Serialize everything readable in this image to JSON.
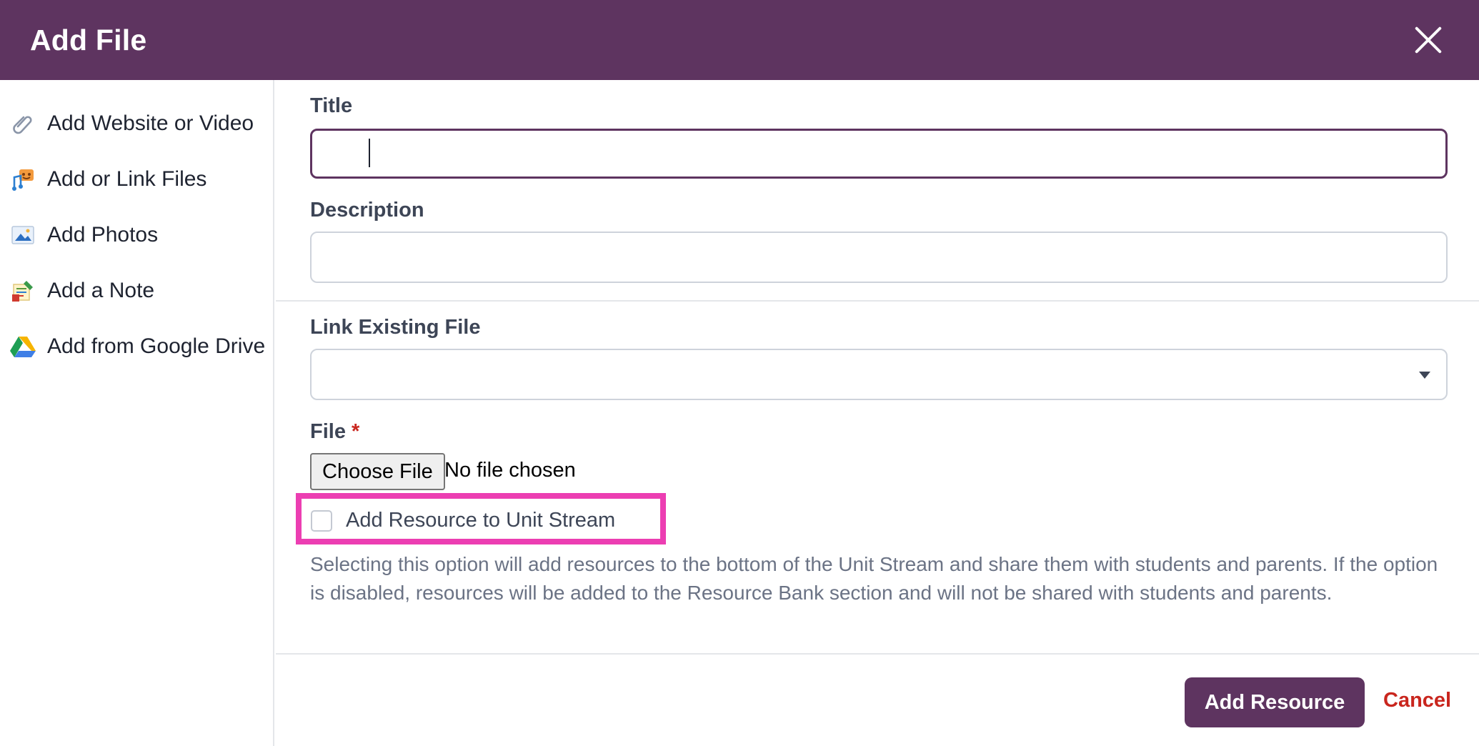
{
  "dialog": {
    "title": "Add File",
    "close_icon": "close-icon"
  },
  "sidebar": {
    "items": [
      {
        "label": "Add Website or Video",
        "icon": "paperclip-icon"
      },
      {
        "label": "Add or Link Files",
        "icon": "media-files-icon"
      },
      {
        "label": "Add Photos",
        "icon": "photo-icon"
      },
      {
        "label": "Add a Note",
        "icon": "note-icon"
      },
      {
        "label": "Add from Google Drive",
        "icon": "google-drive-icon"
      }
    ]
  },
  "form": {
    "title_label": "Title",
    "title_value": "",
    "description_label": "Description",
    "description_value": "",
    "link_existing_label": "Link Existing File",
    "link_existing_value": "",
    "file_label": "File",
    "file_required_mark": "*",
    "choose_file_label": "Choose File",
    "file_status": "No file chosen",
    "unit_stream_checkbox_label": "Add Resource to Unit Stream",
    "unit_stream_checked": false,
    "help_text": "Selecting this option will add resources to the bottom of the Unit Stream and share them with students and parents. If the option is disabled, resources will be added to the Resource Bank section and will not be shared with students and parents."
  },
  "footer": {
    "primary_label": "Add Resource",
    "cancel_label": "Cancel"
  },
  "colors": {
    "brand": "#5e3460",
    "danger": "#c9261e",
    "highlight": "#ec3eb2"
  }
}
